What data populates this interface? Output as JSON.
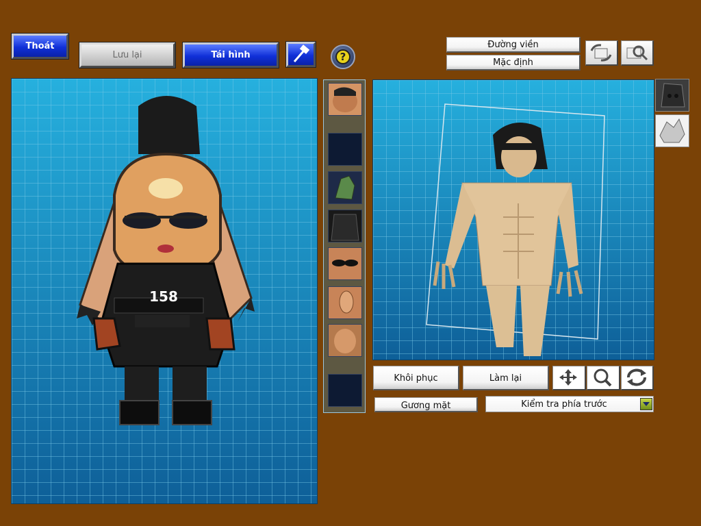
{
  "toolbar": {
    "exit_label": "Thoát",
    "save_label": "Lưu lại",
    "regenerate_label": "Tái hình"
  },
  "view_options": {
    "outline_label": "Đường viền",
    "default_label": "Mặc định"
  },
  "preview": {
    "jersey_number": "158"
  },
  "controls": {
    "restore_label": "Khôi phục",
    "redo_label": "Làm lại",
    "face_label": "Gương mặt",
    "view_select_value": "Kiểm tra phía trước"
  },
  "colors": {
    "background": "#7a4206",
    "grid_blue": "#1a8cc0",
    "button_blue": "#1030d8"
  }
}
